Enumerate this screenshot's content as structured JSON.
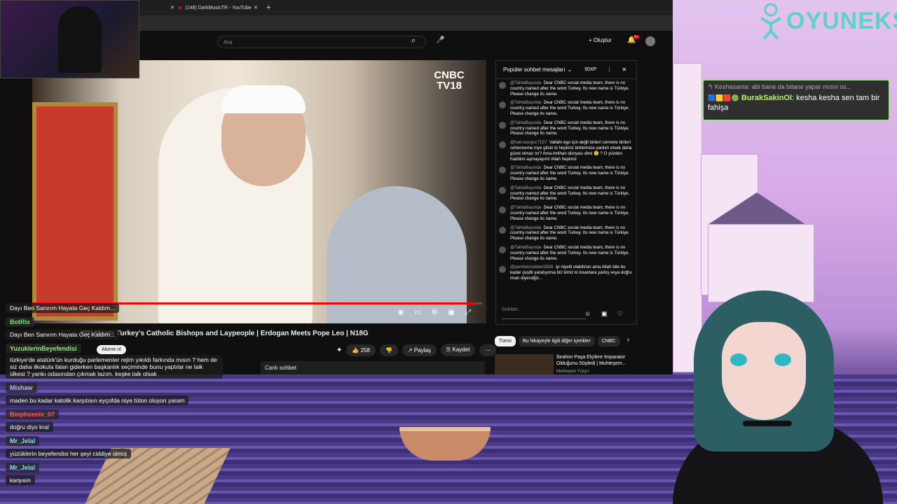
{
  "browser": {
    "tab_active": "(148) DarkMusicTR - YouTube",
    "search_placeholder": "Ara",
    "create_label": "Oluştur",
    "notif_badge": "9+"
  },
  "video": {
    "logo_top": "CNBC",
    "logo_bottom": "TV18",
    "title": "XB) Meets Turkey's Catholic Bishops and Laypeople | Erdogan Meets Pope Leo | N18G",
    "subscribe": "Abone ol",
    "likes": "258",
    "share": "Paylaş",
    "save": "Kaydet",
    "live_chat_label": "Canlı sohbet",
    "progress": 0.985
  },
  "chat": {
    "header": "Popüler sohbet mesajları",
    "xp": "50XP",
    "input_placeholder": "Sohbet...",
    "messages": [
      {
        "user": "@TahtaBaşında",
        "text": "Dear CNBC social media team, there is no country named after the word Turkey. Its new name is Türkiye. Please change its name."
      },
      {
        "user": "@TahtaBaşında",
        "text": "Dear CNBC social media team, there is no country named after the word Turkey. Its new name is Türkiye. Please change its name."
      },
      {
        "user": "@TahtaBaşında",
        "text": "Dear CNBC social media team, there is no country named after the word Turkey. Its new name is Türkiye. Please change its name."
      },
      {
        "user": "@hatıcearguc7157",
        "text": "Vallahi ego için değil birileri cennete birileri cehenneme niye gitsin ki hepimiz birbirimize yardım etsek daha güzel olmaz mı? Ama imtihan dünyası dimi 😊 ? O yüzden haddimi aşmayayım! Allah hepimiz"
      },
      {
        "user": "@TahtaBaşında",
        "text": "Dear CNBC social media team, there is no country named after the word Turkey. Its new name is Türkiye. Please change its name."
      },
      {
        "user": "@TahtaBaşında",
        "text": "Dear CNBC social media team, there is no country named after the word Turkey. Its new name is Türkiye. Please change its name."
      },
      {
        "user": "@TahtaBaşında",
        "text": "Dear CNBC social media team, there is no country named after the word Turkey. Its new name is Türkiye. Please change its name."
      },
      {
        "user": "@TahtaBaşında",
        "text": "Dear CNBC social media team, there is no country named after the word Turkey. Its new name is Türkiye. Please change its name."
      },
      {
        "user": "@TahtaBaşında",
        "text": "Dear CNBC social media team, there is no country named after the word Turkey. Its new name is Türkiye. Please change its name."
      },
      {
        "user": "@pembecicekleri2839",
        "text": "iyi niyetli olabilirsin ama Allah bile bu kadar çeşitli yaratıyorsa biz kimiz ki insanlara yanlış veya doğru iman diyeceğiz..."
      }
    ]
  },
  "sidebar": {
    "chips": [
      "Tümü",
      "Bu hikayeyle ilgili diğer içerikler",
      "CNBC"
    ],
    "rec_title": "İbrahim Paşa Elçilere İmparator Olduğunu Söyledi | Muhteşem...",
    "rec_channel": "Muhteşem Yüzyıl"
  },
  "brand": {
    "name": "OYUNEKS"
  },
  "alert": {
    "reply": "Keshasama: abi bana da bitane yapar mısın isi...",
    "user": "BurakSakinOl",
    "text": ": kesha kesha sen tam bir fahişa"
  },
  "overlay_chat": [
    {
      "user": "",
      "msg": "Dayı Ben Sanırım Hayata Geç Kaldım..."
    },
    {
      "user": "BotRix",
      "msg": "Dayı Ben Sanırım Hayata Geç Kaldım..."
    },
    {
      "user": "YuzuklerinBeyefendisi",
      "msg": "türkiye'de atatürk'ün kurduğu parlementer rejim yıkıldı farkında mısın ? hem de siz daha ilkokula falan giderken başkanlık seçiminde bunu yaptılar ne laik ülkesi ? yankı odasından çıkmak lazım. keşke laik olsak"
    },
    {
      "user": "Mishaw",
      "msg": "maden bu kadar katolik karşıtısın eyçofda niye tüton oluyon yaram"
    },
    {
      "user": "Biophoenix_07",
      "msg": "doğru diyo kral"
    },
    {
      "user": "Mr_Jelal",
      "msg": "yüzüklerin beyefendisi her şeyi ciddiye almış"
    },
    {
      "user": "Mr_Jelal",
      "msg": "karşısın"
    }
  ],
  "colors": {
    "accent": "#5fd1c8",
    "alert_border": "#9be38c",
    "alert_user": "#b6f36a",
    "yt_red": "#ff0000"
  }
}
